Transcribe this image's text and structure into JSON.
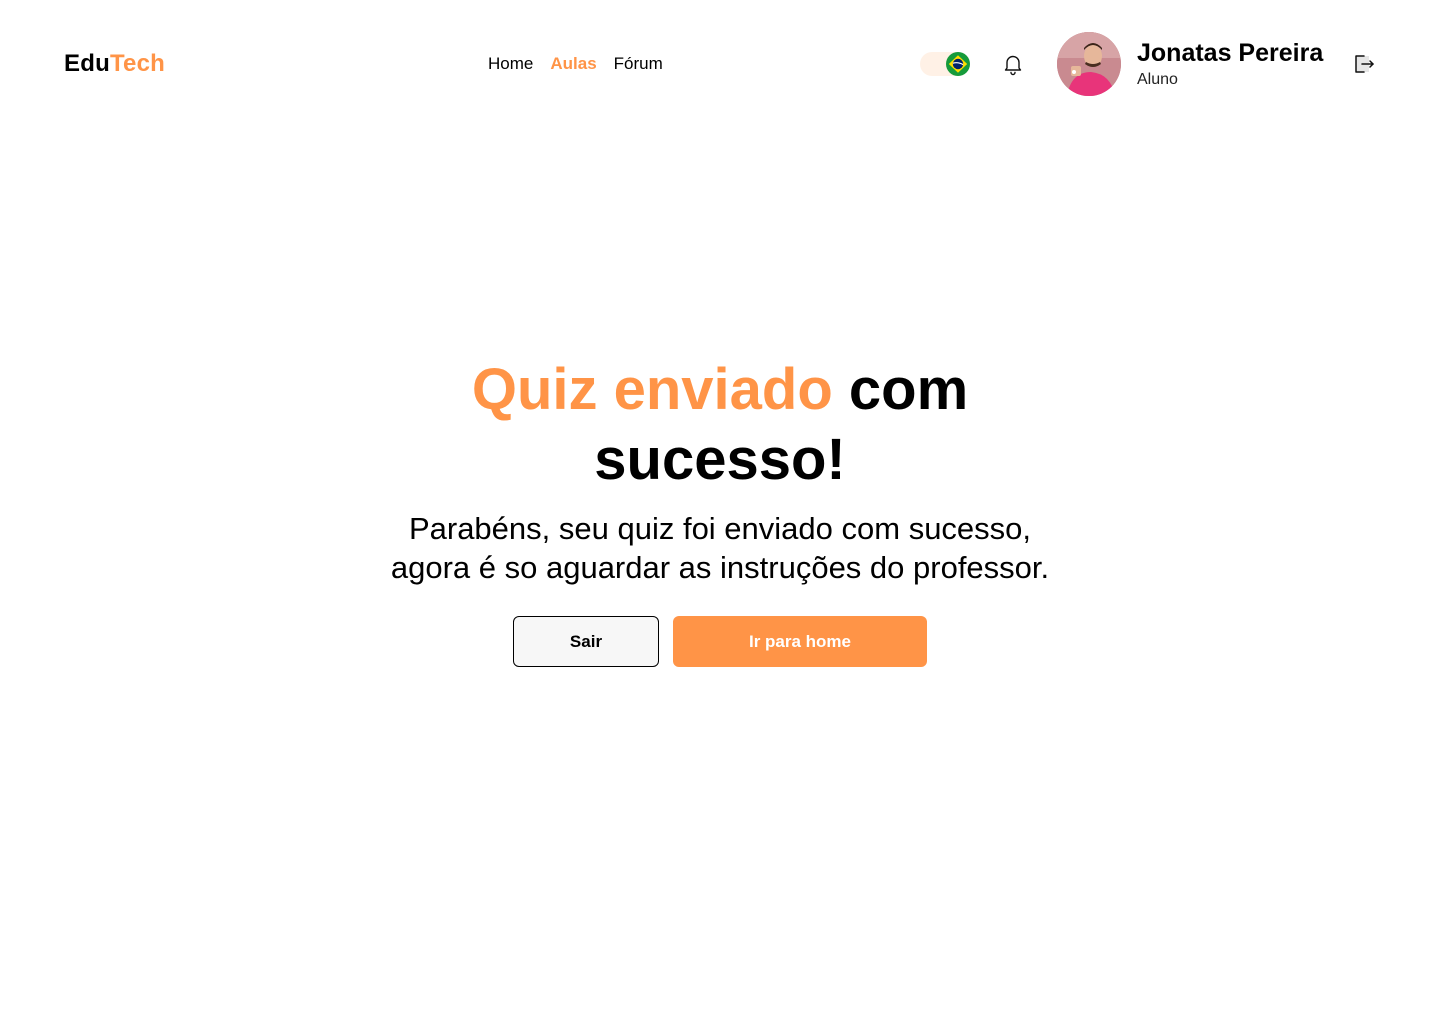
{
  "header": {
    "logo": {
      "part1": "Edu",
      "part2": "Tech"
    },
    "nav": [
      {
        "label": "Home",
        "active": false
      },
      {
        "label": "Aulas",
        "active": true
      },
      {
        "label": "Fórum",
        "active": false
      }
    ],
    "language": {
      "flag_icon": "brazil-flag-icon",
      "selected": "pt-BR"
    },
    "notifications_icon": "bell-icon",
    "user": {
      "name": "Jonatas Pereira",
      "role": "Aluno"
    },
    "logout_icon": "logout-icon"
  },
  "main": {
    "title_highlight": "Quiz enviado",
    "title_rest": " com sucesso!",
    "subtitle_line1": "Parabéns, seu quiz foi enviado com sucesso,",
    "subtitle_line2": "agora é so aguardar as instruções do professor.",
    "buttons": {
      "exit": "Sair",
      "home": "Ir para home"
    }
  },
  "colors": {
    "accent": "#FF9447",
    "toggle_bg": "#FFF1E6",
    "text": "#000000"
  }
}
